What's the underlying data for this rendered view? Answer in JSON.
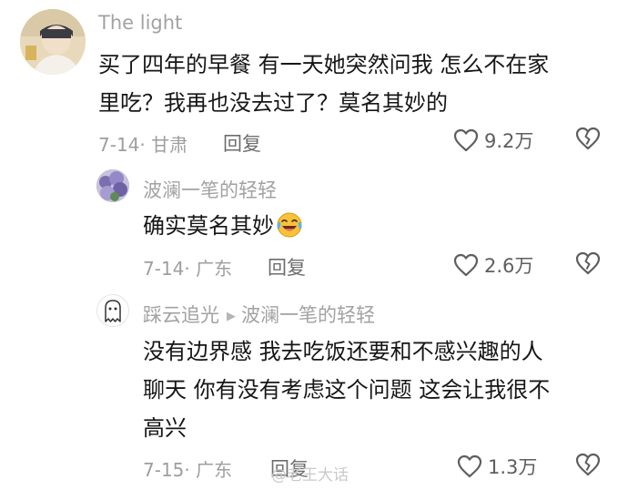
{
  "comments": [
    {
      "username": "The light",
      "text_line1": "买了四年的早餐  有一天她突然问我  怎么不在家",
      "text_line2": "里吃？我再也没去过了？莫名其妙的",
      "date": "7-14",
      "location": "甘肃",
      "reply_label": "回复",
      "likes": "9.2万"
    },
    {
      "username": "波澜一笔的轻轻",
      "text": "确实莫名其妙",
      "emoji": "laughing-crying-emoji",
      "date": "7-14",
      "location": "广东",
      "reply_label": "回复",
      "likes": "2.6万"
    },
    {
      "username": "踩云追光",
      "reply_to": "波澜一笔的轻轻",
      "text_line1": "没有边界感  我去吃饭还要和不感兴趣的人",
      "text_line2": "聊天  你有没有考虑这个问题  这会让我很不",
      "text_line3": "高兴",
      "date": "7-15",
      "location": "广东",
      "reply_label": "回复",
      "likes": "1.3万"
    }
  ],
  "watermark": "@老王大话",
  "icons": {
    "like": "heart-outline-icon",
    "dislike": "broken-heart-icon",
    "reply_arrow": "triangle-right-icon"
  },
  "colors": {
    "username": "#a2a2a2",
    "text": "#161616",
    "meta": "#9e9e9e",
    "icon": "#5e5e5e"
  }
}
